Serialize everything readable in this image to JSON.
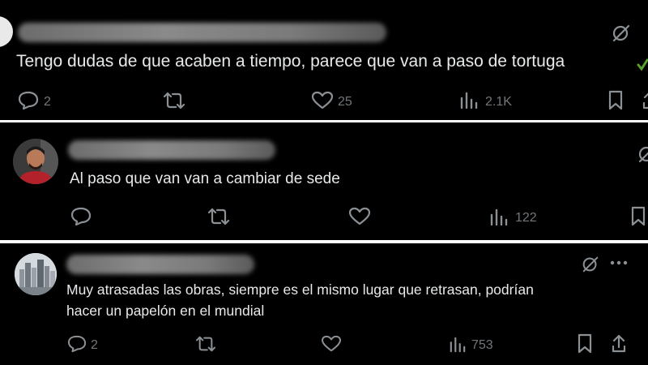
{
  "posts": [
    {
      "text": "Tengo dudas de que acaben a tiempo, parece que van a paso de tortuga",
      "replies": "2",
      "likes": "25",
      "views": "2.1K",
      "avatar": "partial-avatar"
    },
    {
      "text": "Al paso que van van a cambiar de sede",
      "views": "122",
      "avatar": "man-portrait-avatar"
    },
    {
      "text_line1": "Muy atrasadas las obras, siempre es el mismo lugar que retrasan, podrían",
      "text_line2": "hacer un papelón en el mundial",
      "replies": "2",
      "views": "753",
      "avatar": "city-skyline-avatar"
    }
  ],
  "colors": {
    "background": "#000000",
    "text": "#e7e9ea",
    "muted": "#71767b",
    "divider": "#ffffff",
    "emoji_green": "#5aa02c"
  }
}
